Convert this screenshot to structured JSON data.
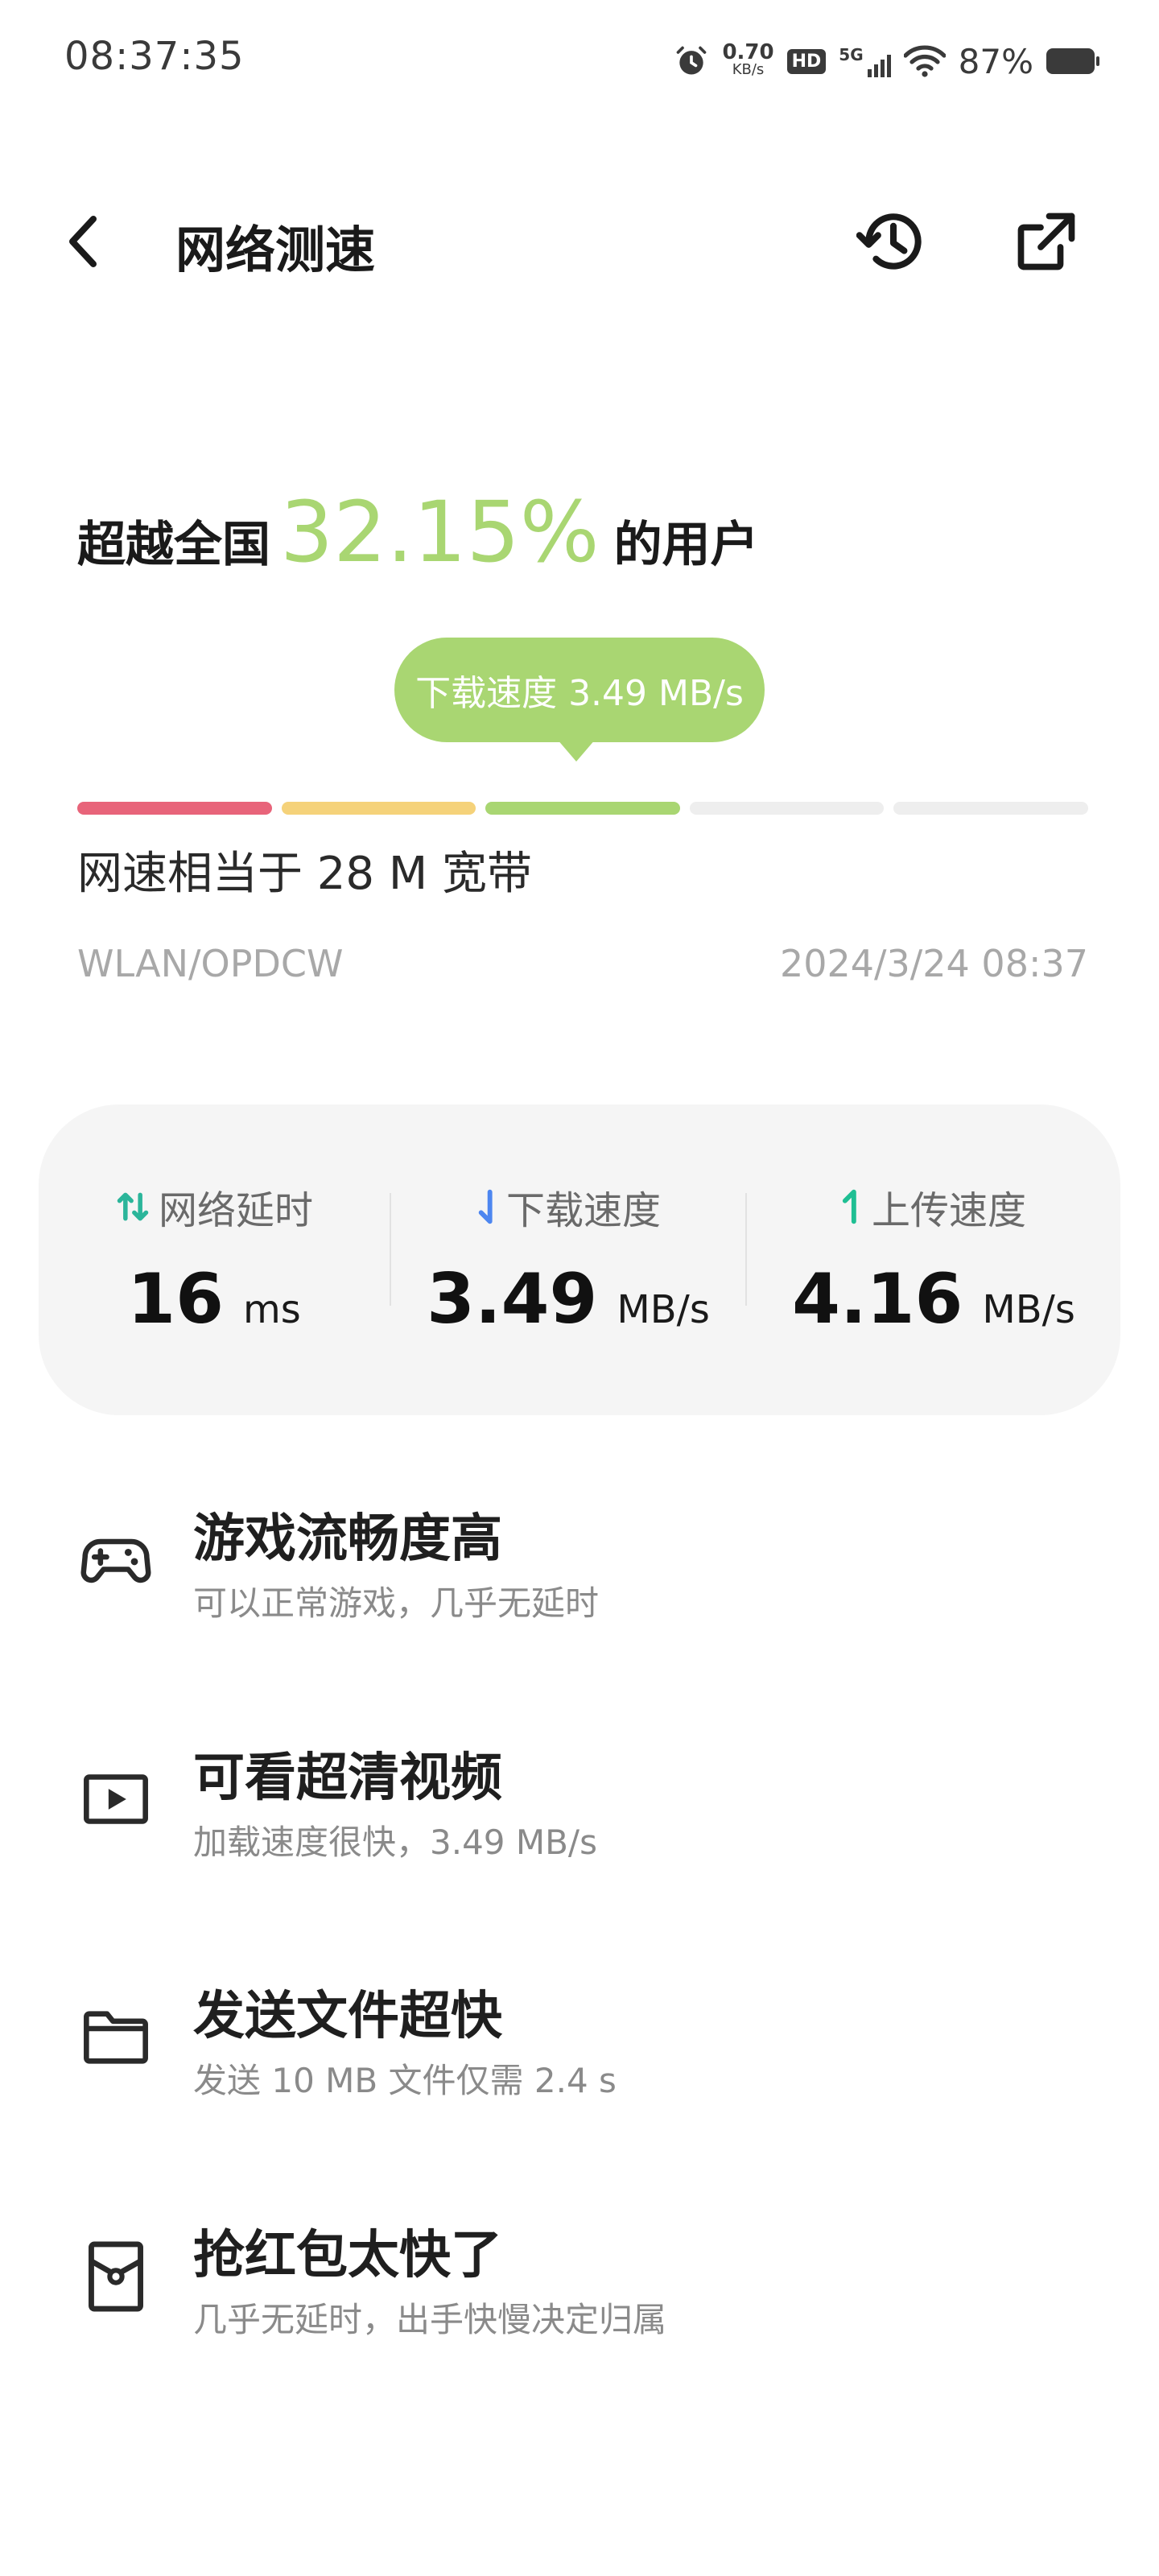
{
  "status_bar": {
    "time": "08:37:35",
    "net_speed_value": "0.70",
    "net_speed_unit": "KB/s",
    "hd_label": "HD",
    "network_type": "5G",
    "battery_percent": "87%"
  },
  "header": {
    "title": "网络测速"
  },
  "ranking": {
    "prefix": "超越全国",
    "percent": "32.15%",
    "suffix": "的用户"
  },
  "speed_bubble": {
    "text": "下载速度 3.49 MB/s"
  },
  "level_bar": {
    "colors": [
      "#e8647a",
      "#f5d27a",
      "#a9d672",
      "#eeeeee",
      "#eeeeee"
    ],
    "active_segments": 3
  },
  "bandwidth": "网速相当于 28 M 宽带",
  "network_name": "WLAN/OPDCW",
  "test_time": "2024/3/24 08:37",
  "metrics": {
    "latency": {
      "label": "网络延时",
      "value": "16",
      "unit": "ms"
    },
    "download": {
      "label": "下载速度",
      "value": "3.49",
      "unit": "MB/s"
    },
    "upload": {
      "label": "上传速度",
      "value": "4.16",
      "unit": "MB/s"
    }
  },
  "features": [
    {
      "icon": "gamepad-icon",
      "title": "游戏流畅度高",
      "desc": "可以正常游戏，几乎无延时"
    },
    {
      "icon": "video-icon",
      "title": "可看超清视频",
      "desc": "加载速度很快，3.49 MB/s"
    },
    {
      "icon": "folder-icon",
      "title": "发送文件超快",
      "desc": "发送 10 MB 文件仅需 2.4 s"
    },
    {
      "icon": "red-packet-icon",
      "title": "抢红包太快了",
      "desc": "几乎无延时，出手快慢决定归属"
    }
  ],
  "colors": {
    "accent_green": "#a9d672",
    "latency_icon": "#2bb59a",
    "download_icon": "#4d86f0",
    "upload_icon": "#1fbf93"
  }
}
